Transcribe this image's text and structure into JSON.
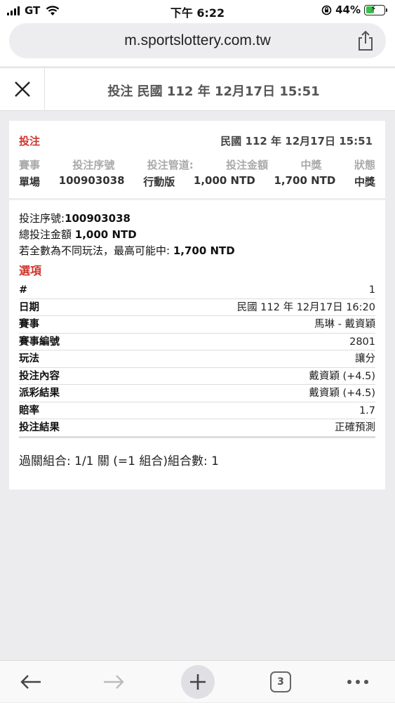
{
  "status_bar": {
    "carrier": "GT",
    "time": "下午 6:22",
    "battery_percent": "44%",
    "battery_level": 0.44,
    "battery_color": "#39c14b"
  },
  "browser": {
    "url": "m.sportslottery.com.tw",
    "share_icon": "share-icon"
  },
  "header": {
    "close_icon": "close-icon",
    "title": "投注 民國 112 年 12月17日 15:51"
  },
  "summary": {
    "label": "投注",
    "date": "民國 112 年 12月17日 15:51",
    "columns": [
      "賽事",
      "投注序號",
      "投注管道:",
      "投注金額",
      "中獎",
      "狀態"
    ],
    "values": [
      "單場",
      "100903038",
      "行動版",
      "1,000 NTD",
      "1,700 NTD",
      "中獎"
    ]
  },
  "details": {
    "serial_label": "投注序號:",
    "serial_value": "100903038",
    "total_label": "總投注金額 ",
    "total_value": "1,000 NTD",
    "max_label": "若全數為不同玩法，最高可能中: ",
    "max_value": "1,700 NTD",
    "options_title": "選項"
  },
  "options": [
    {
      "key": "#",
      "value": "1"
    },
    {
      "key": "日期",
      "value": "民國 112 年 12月17日 16:20"
    },
    {
      "key": "賽事",
      "value": "馬琳 - 戴資穎"
    },
    {
      "key": "賽事編號",
      "value": "2801"
    },
    {
      "key": "玩法",
      "value": "讓分"
    },
    {
      "key": "投注內容",
      "value": "戴資穎 (+4.5)"
    },
    {
      "key": "派彩結果",
      "value": "戴資穎 (+4.5)"
    },
    {
      "key": "賠率",
      "value": "1.7"
    },
    {
      "key": "投注結果",
      "value": "正確預測"
    }
  ],
  "parlay": "過關組合: 1/1 關 (=1 組合)組合數: 1",
  "toolbar": {
    "back_icon": "back-arrow-icon",
    "forward_icon": "forward-arrow-icon",
    "new_tab_icon": "plus-icon",
    "tab_count": "3",
    "more_icon": "more-icon"
  },
  "colors": {
    "accent_red": "#d0342c",
    "muted_header": "#aaaaaa"
  }
}
